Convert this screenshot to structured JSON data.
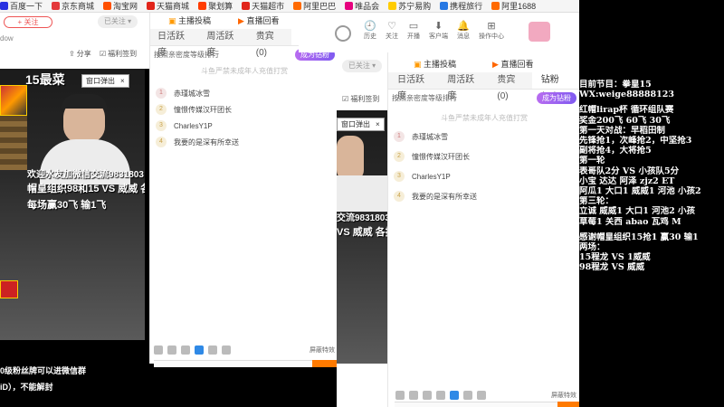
{
  "bookmarks": [
    {
      "label": "百度一下",
      "icon": "baidu-icon",
      "color": "#2932e1"
    },
    {
      "label": "京东商城",
      "icon": "jd-icon",
      "color": "#e4393c"
    },
    {
      "label": "淘宝网",
      "icon": "taobao-icon",
      "color": "#ff5000"
    },
    {
      "label": "天猫商城",
      "icon": "tmall-icon",
      "color": "#e1251b"
    },
    {
      "label": "聚划算",
      "icon": "juhuasuan-icon",
      "color": "#ff3c00"
    },
    {
      "label": "天猫超市",
      "icon": "tmall-market-icon",
      "color": "#e1251b"
    },
    {
      "label": "阿里巴巴",
      "icon": "alibaba-icon",
      "color": "#ff6a00"
    },
    {
      "label": "唯品会",
      "icon": "vip-icon",
      "color": "#e6007e"
    },
    {
      "label": "苏宁易购",
      "icon": "suning-icon",
      "color": "#ffcc00"
    },
    {
      "label": "携程旅行",
      "icon": "ctrip-icon",
      "color": "#2577e3"
    },
    {
      "label": "阿里1688",
      "icon": "1688-icon",
      "color": "#ff6a00"
    }
  ],
  "top_bar": {
    "follow_btn": "+ 关注",
    "followed_btn": "已关注",
    "window_fragment": "dow",
    "share": "分享",
    "welfare": "福利签到"
  },
  "header_nav": [
    {
      "label": "历史"
    },
    {
      "label": "关注"
    },
    {
      "label": "开播"
    },
    {
      "label": "客户端"
    },
    {
      "label": "消息"
    },
    {
      "label": "操作中心"
    }
  ],
  "anchor_tabs": {
    "schedule": "主播投稿",
    "replay": "直播回看"
  },
  "rank_tabs": [
    "日活跃度",
    "周活跃度",
    "贵宾(0)",
    "钻粉(26)"
  ],
  "rank_tip": "按照亲密度等级排行",
  "become_fan": "成为钻粉",
  "notice": "斗鱼严禁未成年人充值打赏",
  "rank_list": [
    "赤瑾城冰雪",
    "憧憬传媒汉玕团长",
    "CharlesY1P",
    "我要的是深有所幸送"
  ],
  "popup": {
    "label": "窗口弹出",
    "close": "×"
  },
  "block_effects": "屏蔽特效",
  "video_overlay": {
    "title": "15最菜",
    "line1": "欢迎水友加微信交流9831803",
    "line2": "帽皇组织98和15 VS 威威 各抢1",
    "line3": "每场赢30飞 输1飞",
    "line2b": "交流9831803",
    "line3b": "VS 威威 各抢1"
  },
  "bottom_text": {
    "line1": "0级粉丝牌可以进微信群",
    "line2": "iD），不能解封"
  },
  "right_info": [
    "目前节目：拳皇15",
    "WX:weige88888123",
    "",
    "红帽lirap杯 循环组队赛",
    "奖金200飞 60飞 30飞",
    "第一天对战：早稻田制",
    "先锋抢1，次峰抢2，中坚抢3",
    "副将抢4，大将抢5",
    "第一轮",
    "表哥队2分 VS 小孩队5分",
    "小宝 达达 阿泽 zjz2 ET",
    "阿瓜1 大口1 威威1 河池 小孩2",
    "第三轮：",
    "立诚 威威1 大口1 河池2 小孩",
    "草莓1 关西 abao 瓦鸡 M",
    "",
    "感谢帽皇组织15抢1 赢30 输1",
    "两场：",
    "15程龙 VS 1威威",
    "98程龙 VS 威威"
  ],
  "colors": {
    "accent_purple": "#7f5af0",
    "accent_orange": "#ff7a00",
    "fan_red": "#e94c4c"
  }
}
